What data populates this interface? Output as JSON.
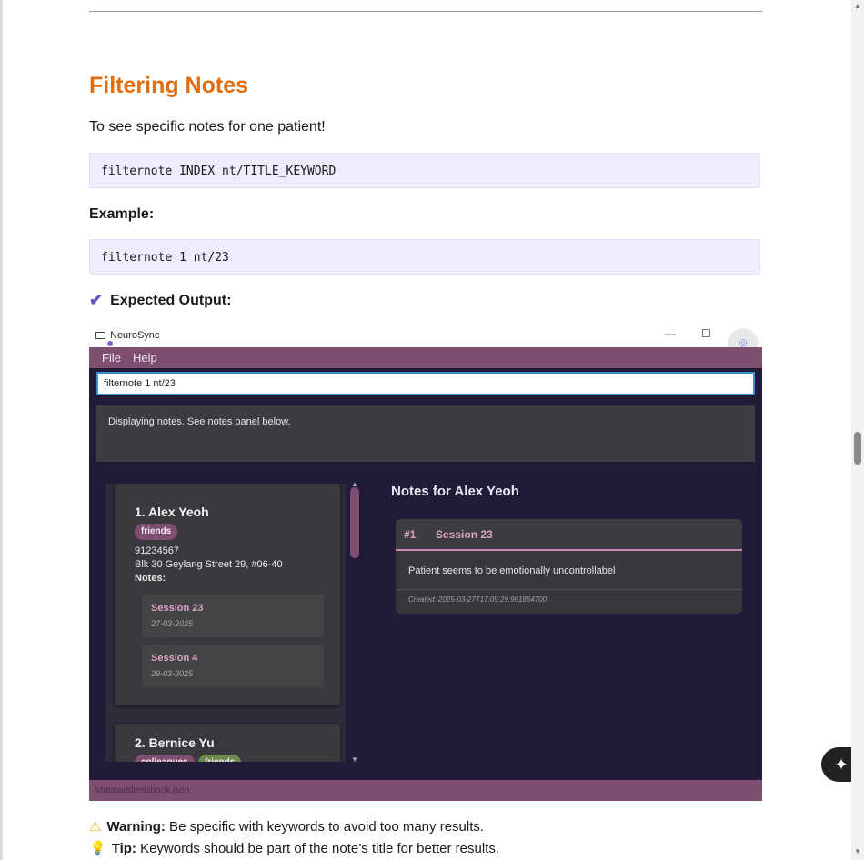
{
  "section": {
    "title": "Filtering Notes",
    "intro": "To see specific notes for one patient!",
    "syntax": "filternote INDEX nt/TITLE_KEYWORD",
    "example_label": "Example:",
    "example_code": "filternote 1 nt/23",
    "expected_label": "Expected Output:"
  },
  "app": {
    "window_title": "NeuroSync",
    "controls": {
      "minimize": "—",
      "maximize": "☐",
      "close": "✕"
    },
    "menu": [
      "File",
      "Help"
    ],
    "command_input": "filternote 1 nt/23",
    "result_message": "Displaying notes. See notes panel below.",
    "persons": [
      {
        "name": "1.  Alex Yeoh",
        "tags": [
          "friends"
        ],
        "phone": "91234567",
        "address": "Blk 30 Geylang Street 29, #06-40",
        "notes_label": "Notes:",
        "notes": [
          {
            "title": "Session 23",
            "date": "27-03-2025"
          },
          {
            "title": "Session 4",
            "date": "29-03-2025"
          }
        ]
      },
      {
        "name": "2.  Bernice Yu",
        "tags": [
          "colleagues",
          "friends"
        ]
      }
    ],
    "notes_panel": {
      "heading": "Notes for Alex Yeoh",
      "note": {
        "number": "#1",
        "title": "Session 23",
        "content": "Patient seems to be emotionally uncontrollabel",
        "created": "Created: 2025-03-27T17:05:29.961864700"
      }
    },
    "status_bar": ".\\data\\addressbook.json",
    "colors": {
      "accent": "#7e4f71",
      "background": "#221b38",
      "note_title": "#d9a6c7"
    }
  },
  "callouts": {
    "warning_label": "Warning:",
    "warning_text": " Be specific with keywords to avoid too many results.",
    "tip_label": "Tip:",
    "tip_text": " Keywords should be part of the note’s title for better results."
  },
  "icons": {
    "check": "check-icon",
    "warning": "warning-icon",
    "tip": "lightbulb-icon",
    "lens": "lens-icon",
    "ai": "sparkle-icon"
  }
}
